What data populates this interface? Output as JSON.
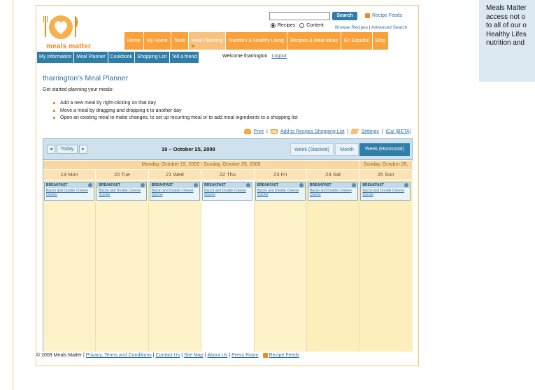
{
  "side_panel": {
    "lines": [
      "Meals Matter",
      "access not o",
      "to all of our o",
      "Healthy Lifes",
      "nutrition and"
    ]
  },
  "header": {
    "logo_text": "meals matter",
    "search_button": "Search",
    "recipe_feeds": "Recipe Feeds",
    "radio_recipes": "Recipes",
    "radio_content": "Content",
    "browse_recipes": "Browse Recipes",
    "advanced_search": "Advanced Search",
    "browse_sep": " | "
  },
  "main_nav": [
    "Home",
    "My Home",
    "Tools",
    "Meal Planning",
    "Nutrition & Healthy Living",
    "Recipes & Meal Ideas",
    "En Español",
    "Blog"
  ],
  "sub_nav": [
    "My Information",
    "Meal Planner",
    "Cookbook",
    "Shopping List",
    "Tell a friend"
  ],
  "welcome": "Welcome tharrington",
  "logout": "Logout",
  "page_title": "tharrington's Meal Planner",
  "intro": "Get started planning your meals:",
  "tips": [
    "Add a new meal by right-clicking on that day",
    "Move a meal by dragging and dropping it to another day",
    "Open an existing meal to make changes, to set up recurring meal or to add meal ingredients to a shopping list"
  ],
  "actions": {
    "print": "Print",
    "add_shopping": "Add to Recipes Shopping List",
    "settings": "Settings",
    "ical": "iCal (BETA)",
    "sep": "|"
  },
  "calendar": {
    "prev": "◂",
    "today": "Today",
    "next": "▸",
    "date_range": "19 – October 25, 2009",
    "view_stacked": "Week (Stacked)",
    "view_month": "Month",
    "view_horizontal": "Week (Horizontal)",
    "week_band_main": "Monday, October 19, 2009 - Sunday, October 25, 2009",
    "week_band_end": "Sunday, October 25,",
    "days": [
      "19 Mon",
      "20 Tue",
      "21 Wed",
      "22 Thu",
      "23 Fri",
      "24 Sat",
      "25 Sun"
    ],
    "meal_type": "BREAKFAST",
    "meal_name": "Bacon and Double Cheese Quiche"
  },
  "footer": {
    "copyright": "© 2009 Meals Matter |",
    "links": [
      "Privacy, Terms and Conditions",
      "Contact Us",
      "Site Map",
      "About Us",
      "Press Room"
    ],
    "sep": "|",
    "recipe_feeds": "Recipe Feeds"
  },
  "colors": {
    "orange": "#f9a23c",
    "blue": "#2f7ea8",
    "link": "#2f6f9f"
  }
}
